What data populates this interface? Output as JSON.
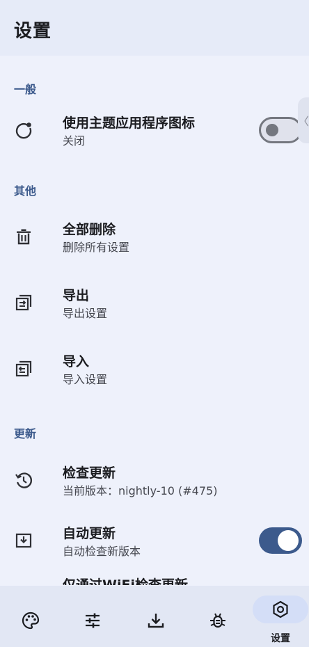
{
  "app": {
    "title": "设置"
  },
  "sections": {
    "general": "一般",
    "other": "其他",
    "update": "更新"
  },
  "items": {
    "themed_icon": {
      "title": "使用主题应用程序图标",
      "subtitle": "关闭",
      "icon": "theme-refresh-icon",
      "toggle": false
    },
    "delete_all": {
      "title": "全部删除",
      "subtitle": "删除所有设置",
      "icon": "trash-icon"
    },
    "export": {
      "title": "导出",
      "subtitle": "导出设置",
      "icon": "export-icon"
    },
    "import": {
      "title": "导入",
      "subtitle": "导入设置",
      "icon": "import-icon"
    },
    "check_update": {
      "title": "检查更新",
      "subtitle": "当前版本：nightly-10 (#475)",
      "icon": "history-icon"
    },
    "auto_update": {
      "title": "自动更新",
      "subtitle": "自动检查新版本",
      "icon": "download-box-icon",
      "toggle": true
    },
    "wifi_only": {
      "title": "仅通过WiFi检查更新"
    }
  },
  "edge_handle": "〈",
  "nav": {
    "items": [
      {
        "icon": "palette-icon"
      },
      {
        "icon": "tune-icon"
      },
      {
        "icon": "download-icon"
      },
      {
        "icon": "bug-icon"
      },
      {
        "icon": "settings-icon",
        "label": "设置",
        "active": true
      }
    ]
  },
  "colors": {
    "accent": "#3c5a8c",
    "background": "#eef1fb",
    "appbar": "#e6ebf8",
    "navbar": "#e2e7f4",
    "nav_active": "#d4def7"
  }
}
